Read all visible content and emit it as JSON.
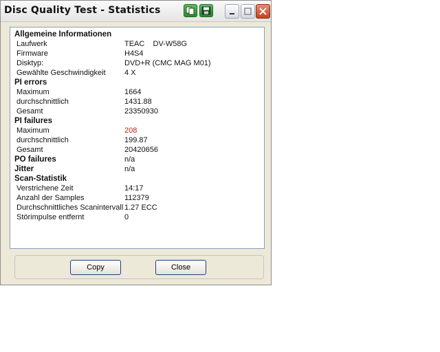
{
  "window": {
    "title": "Disc Quality Test - Statistics",
    "icons": [
      "copy-icon",
      "save-icon"
    ],
    "controls": [
      "minimize-icon",
      "maximize-icon",
      "close-icon"
    ]
  },
  "stats": {
    "general": {
      "heading": "Allgemeine Informationen",
      "rows": [
        {
          "label": "Laufwerk",
          "value": "TEAC    DV-W58G"
        },
        {
          "label": "Firmware",
          "value": "H4S4"
        },
        {
          "label": "Disktyp:",
          "value": "DVD+R (CMC MAG M01)"
        },
        {
          "label": "Gewählte Geschwindigkeit",
          "value": "4 X"
        }
      ]
    },
    "pi_errors": {
      "heading": "PI errors",
      "rows": [
        {
          "label": "Maximum",
          "value": "1664"
        },
        {
          "label": "durchschnittlich",
          "value": "1431.88"
        },
        {
          "label": "Gesamt",
          "value": "23350930"
        }
      ]
    },
    "pi_failures": {
      "heading": "PI failures",
      "rows": [
        {
          "label": "Maximum",
          "value": "208"
        },
        {
          "label": "durchschnittlich",
          "value": "199.87"
        },
        {
          "label": "Gesamt",
          "value": "20420656"
        }
      ]
    },
    "po_failures": {
      "heading": "PO failures",
      "value": "n/a"
    },
    "jitter": {
      "heading": "Jitter",
      "value": "n/a"
    },
    "scan": {
      "heading": "Scan-Statistik",
      "rows": [
        {
          "label": "Verstrichene Zeit",
          "value": "14:17"
        },
        {
          "label": "Anzahl der Samples",
          "value": "112379"
        },
        {
          "label": "Durchschnittliches Scanintervall",
          "value": "1.27 ECC"
        },
        {
          "label": "Störimpulse entfernt",
          "value": "0"
        }
      ]
    }
  },
  "colors": {
    "value_text": "#111111",
    "highlight_value": "#b0281a"
  },
  "buttons": {
    "copy": "Copy",
    "close": "Close"
  }
}
